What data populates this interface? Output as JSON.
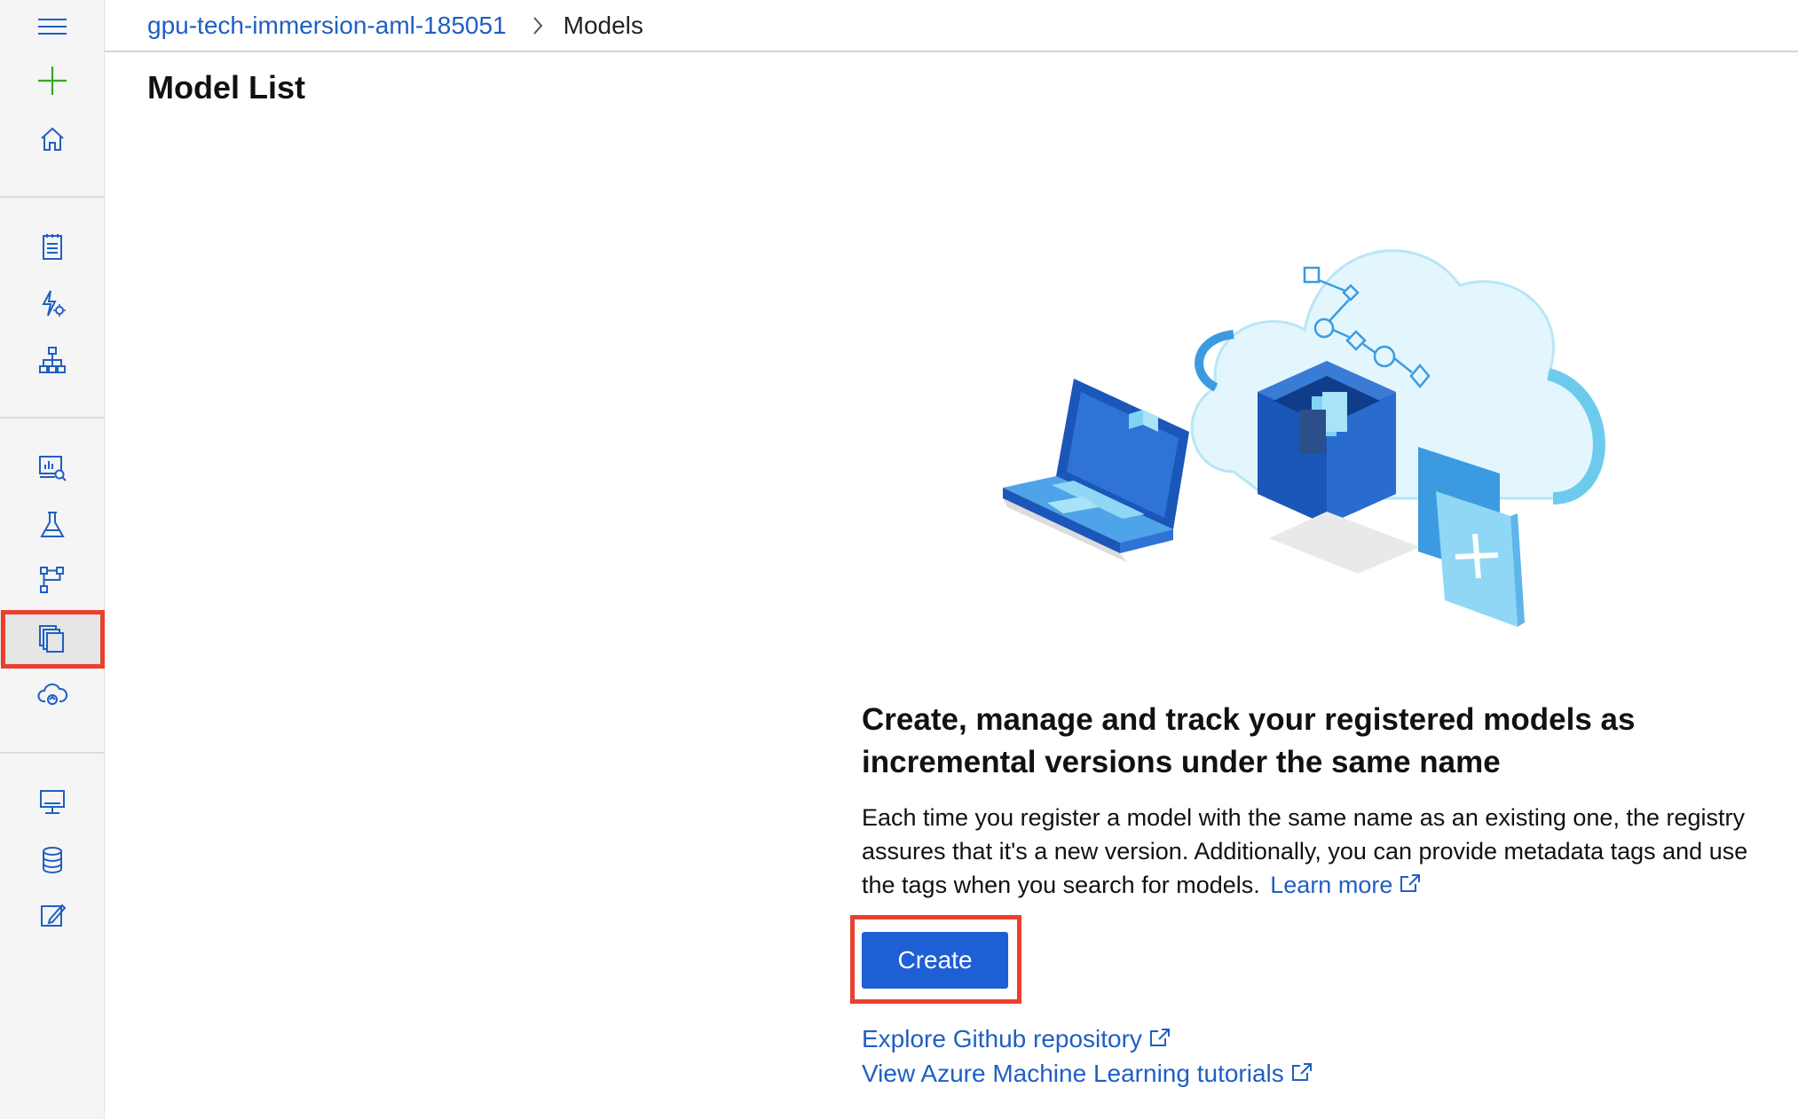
{
  "breadcrumb": {
    "workspace": "gpu-tech-immersion-aml-185051",
    "current": "Models"
  },
  "page": {
    "title": "Model List"
  },
  "empty_state": {
    "headline": "Create, manage and track your registered models as incremental versions under the same name",
    "description": "Each time you register a model with the same name as an existing one, the registry assures that it's a new version. Additionally, you can provide metadata tags and use the tags when you search for models.",
    "learn_more": "Learn more",
    "create_label": "Create",
    "links": [
      {
        "label": "Explore Github repository"
      },
      {
        "label": "View Azure Machine Learning tutorials"
      }
    ]
  },
  "sidebar": {
    "items": [
      {
        "icon": "hamburger-menu-icon"
      },
      {
        "icon": "plus-icon"
      },
      {
        "icon": "home-icon"
      },
      {
        "icon": "notebook-icon"
      },
      {
        "icon": "automated-ml-icon"
      },
      {
        "icon": "designer-icon"
      },
      {
        "icon": "datasets-icon"
      },
      {
        "icon": "experiments-icon"
      },
      {
        "icon": "pipelines-icon"
      },
      {
        "icon": "models-icon",
        "selected": true
      },
      {
        "icon": "endpoints-icon"
      },
      {
        "icon": "compute-icon"
      },
      {
        "icon": "datastores-icon"
      },
      {
        "icon": "data-labeling-icon"
      }
    ]
  },
  "colors": {
    "accent": "#1f5fd6",
    "link": "#1f5fc4",
    "highlight": "#e8412c",
    "plus_green": "#3aa51f"
  }
}
